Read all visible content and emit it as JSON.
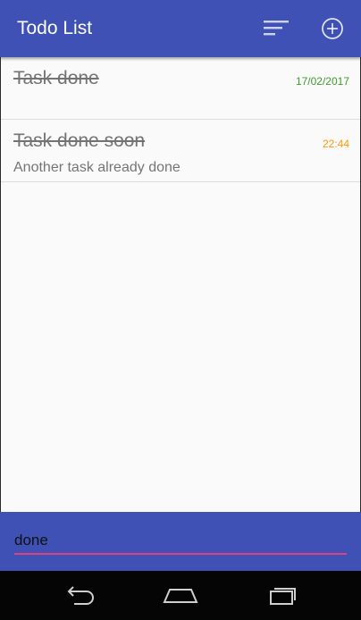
{
  "appbar": {
    "title": "Todo List",
    "sort_icon": "sort-icon",
    "add_icon": "add-circle-icon"
  },
  "tasks": [
    {
      "title": "Task done",
      "description": "",
      "date": "17/02/2017",
      "date_color": "#3f9b2e",
      "completed": true
    },
    {
      "title": "Task done soon",
      "description": "Another task already done",
      "date": "22:44",
      "date_color": "#ff9800",
      "completed": true
    }
  ],
  "search": {
    "value": "done",
    "underline_color": "#e0407b"
  },
  "navbar": {
    "back_icon": "back-icon",
    "home_icon": "home-icon",
    "recents_icon": "recents-icon"
  },
  "colors": {
    "primary": "#3f51b5",
    "background": "#fafafa",
    "text_struck": "#737373"
  }
}
